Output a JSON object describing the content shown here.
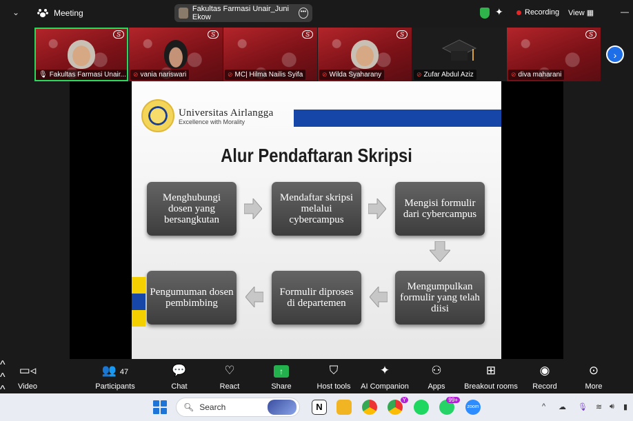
{
  "topbar": {
    "meeting_label": "Meeting",
    "share_label": "Fakultas Farmasi Unair_Juni Ekow",
    "recording_label": "Recording",
    "view_label": "View"
  },
  "participants_strip": [
    {
      "name": "Fakultas Farmasi Unair...",
      "active": true
    },
    {
      "name": "vania nariswari"
    },
    {
      "name": "MC| Hilma Nailis Syifa"
    },
    {
      "name": "Wilda Syaharany"
    },
    {
      "name": "Zufar Abdul Aziz"
    },
    {
      "name": "diva maharani"
    }
  ],
  "slide": {
    "university": "Universitas Airlangga",
    "tagline": "Excellence with Morality",
    "title": "Alur Pendaftaran Skripsi",
    "steps": [
      "Menghubungi dosen yang bersangkutan",
      "Mendaftar skripsi melalui cybercampus",
      "Mengisi formulir dari cybercampus",
      "Mengumpulkan formulir yang telah diisi",
      "Formulir diproses di departemen",
      "Pengumuman dosen pembimbing"
    ]
  },
  "toolbar": {
    "video": "Video",
    "participants": "Participants",
    "participants_count": "47",
    "chat": "Chat",
    "react": "React",
    "share": "Share",
    "host_tools": "Host tools",
    "ai_companion": "AI Companion",
    "apps": "Apps",
    "breakout": "Breakout rooms",
    "record": "Record",
    "more": "More"
  },
  "taskbar": {
    "search_placeholder": "Search",
    "whatsapp_badge": "99+",
    "zoom_label": "zoom",
    "chrome_badge": "Y"
  },
  "colors": {
    "accent_green": "#2bd95d",
    "record_red": "#e02828",
    "unair_blue": "#1546a8",
    "unair_yellow": "#f5d000"
  }
}
